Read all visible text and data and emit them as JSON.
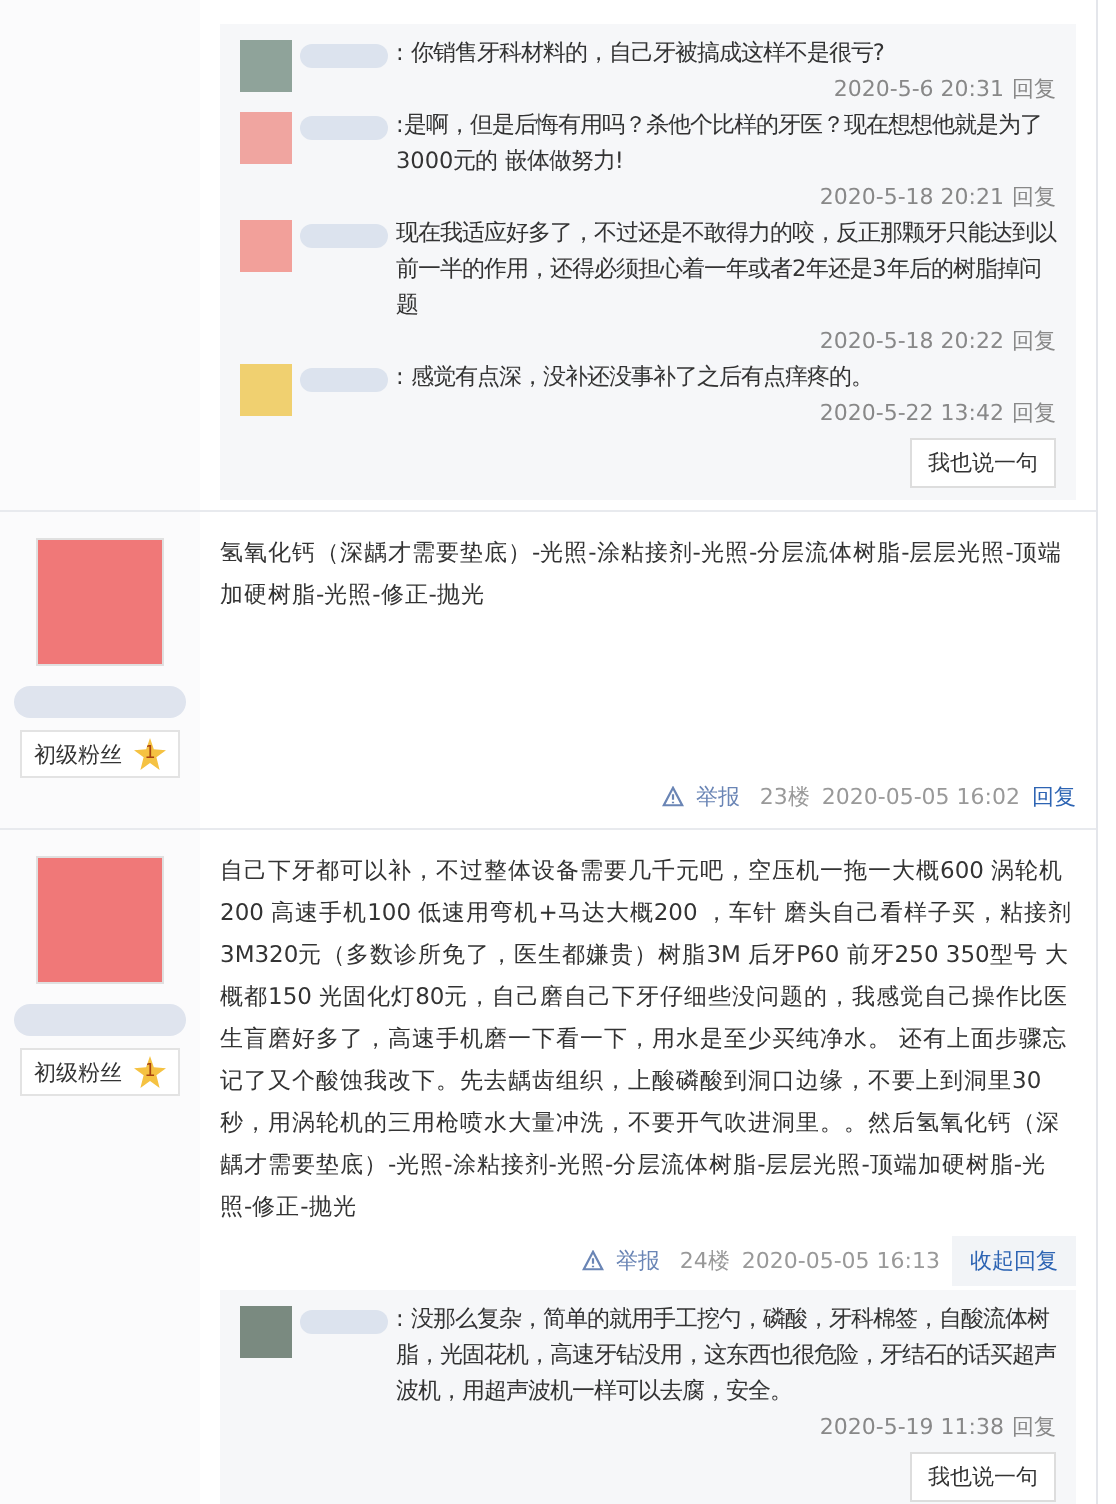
{
  "posts": [
    {
      "replies": [
        {
          "color": "#8fa39a",
          "text": ": 你销售牙科材料的，自己牙被搞成这样不是很亏?",
          "time": "2020-5-6 20:31",
          "reply_label": "回复"
        },
        {
          "color": "#f0a5a0",
          "text": " :是啊，但是后悔有用吗？杀他个比样的牙医？现在想想他就是为了3000元的 嵌体做努力!",
          "time": "2020-5-18 20:21",
          "reply_label": "回复"
        },
        {
          "color": "#f2a09a",
          "text": " 现在我适应好多了，不过还是不敢得力的咬，反正那颗牙只能达到以前一半的作用，还得必须担心着一年或者2年还是3年后的树脂掉问题",
          "time": "2020-5-18 20:22",
          "reply_label": "回复"
        },
        {
          "color": "#f0d070",
          "text": ": 感觉有点深，没补还没事补了之后有点痒疼的。",
          "time": "2020-5-22 13:42",
          "reply_label": "回复"
        }
      ],
      "reply_button": "我也说一句"
    },
    {
      "author": {
        "badge": "初级粉丝",
        "level": "1"
      },
      "content": "氢氧化钙（深龋才需要垫底）-光照-涂粘接剂-光照-分层流体树脂-层层光照-顶端加硬树脂-光照-修正-抛光",
      "meta": {
        "report": "举报",
        "floor": "23楼",
        "time": "2020-05-05 16:02",
        "reply_toggle": "回复",
        "expanded": false
      }
    },
    {
      "author": {
        "badge": "初级粉丝",
        "level": "1"
      },
      "content": "自己下牙都可以补，不过整体设备需要几千元吧，空压机一拖一大概600 涡轮机200 高速手机100 低速用弯机+马达大概200 ，车针 磨头自己看样子买，粘接剂3M320元（多数诊所免了，医生都嫌贵）树脂3M 后牙P60 前牙250 350型号 大概都150 光固化灯80元，自己磨自己下牙仔细些没问题的，我感觉自己操作比医生盲磨好多了，高速手机磨一下看一下，用水是至少买纯净水。 还有上面步骤忘记了又个酸蚀我改下。先去龋齿组织，上酸磷酸到洞口边缘，不要上到洞里30秒，用涡轮机的三用枪喷水大量冲洗，不要开气吹进洞里。。然后氢氧化钙（深龋才需要垫底）-光照-涂粘接剂-光照-分层流体树脂-层层光照-顶端加硬树脂-光照-修正-抛光",
      "meta": {
        "report": "举报",
        "floor": "24楼",
        "time": "2020-05-05 16:13",
        "reply_toggle": "收起回复",
        "expanded": true
      },
      "replies": [
        {
          "color": "#7a8a80",
          "text": ": 没那么复杂，简单的就用手工挖勺，磷酸，牙科棉签，自酸流体树脂，光固花机，高速牙钻没用，这东西也很危险，牙结石的话买超声波机，用超声波机一样可以去腐，安全。",
          "time": "2020-5-19 11:38",
          "reply_label": "回复"
        }
      ],
      "reply_button": "我也说一句"
    }
  ]
}
